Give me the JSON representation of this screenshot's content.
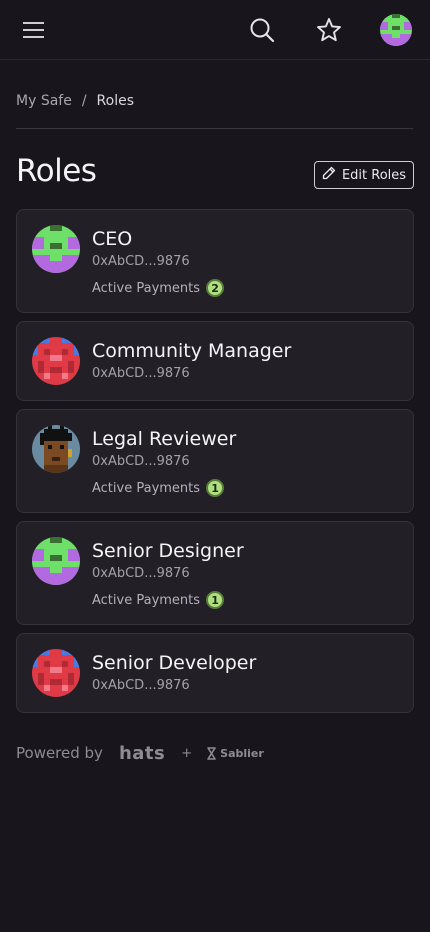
{
  "header": {
    "menu_icon": "hamburger-menu-icon",
    "search_icon": "search-icon",
    "favorites_icon": "star-icon",
    "account_icon": "pixel-avatar"
  },
  "breadcrumb": {
    "parent": "My Safe",
    "separator": "/",
    "current": "Roles"
  },
  "page": {
    "title": "Roles",
    "edit_button_label": "Edit Roles",
    "edit_icon": "pencil-icon"
  },
  "roles": [
    {
      "name": "CEO",
      "address": "0xAbCD...9876",
      "payments_label": "Active Payments",
      "payments_count": "2",
      "avatar": "green-purple-pixel"
    },
    {
      "name": "Community Manager",
      "address": "0xAbCD...9876",
      "avatar": "red-blue-pixel"
    },
    {
      "name": "Legal Reviewer",
      "address": "0xAbCD...9876",
      "payments_label": "Active Payments",
      "payments_count": "1",
      "avatar": "punk-pixel"
    },
    {
      "name": "Senior Designer",
      "address": "0xAbCD...9876",
      "payments_label": "Active Payments",
      "payments_count": "1",
      "avatar": "green-purple-pixel"
    },
    {
      "name": "Senior Developer",
      "address": "0xAbCD...9876",
      "avatar": "red-blue-pixel"
    }
  ],
  "footer": {
    "powered_by": "Powered by",
    "hats": "hats",
    "plus": "+",
    "sablier": "Sablier"
  },
  "colors": {
    "background": "#18161c",
    "card": "#221f27",
    "badge": "#aee07e"
  }
}
